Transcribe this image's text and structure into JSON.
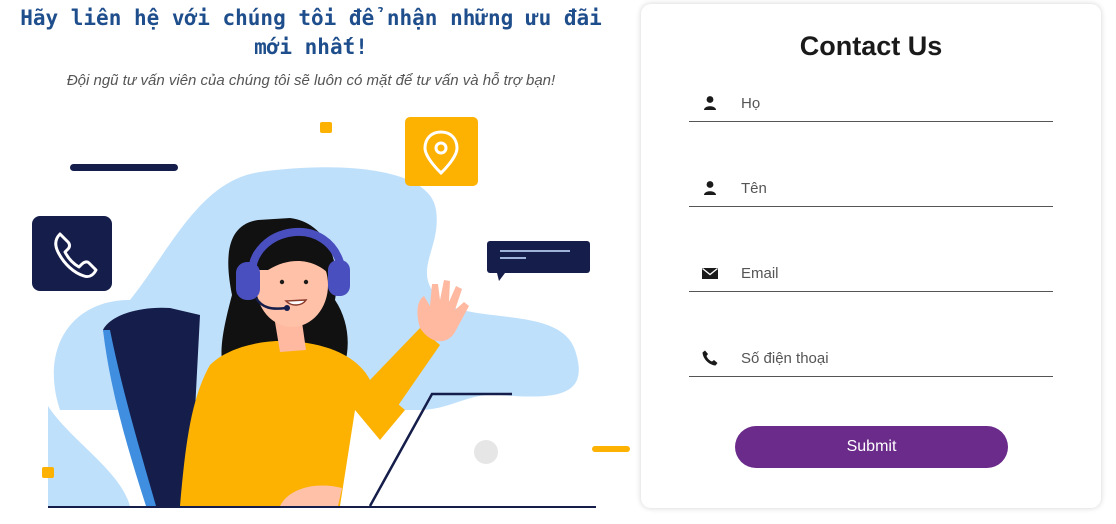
{
  "hero": {
    "headline_line1": "Hãy liên hệ với chúng tôi để nhận những ưu đãi",
    "headline_line2": "mới nhất!",
    "subtitle": "Đội ngũ tư vấn viên của chúng tôi sẽ luôn có mặt để tư vấn và hỗ trợ bạn!"
  },
  "form": {
    "title": "Contact Us",
    "fields": [
      {
        "icon": "user-icon",
        "placeholder": "Họ",
        "value": ""
      },
      {
        "icon": "user-icon",
        "placeholder": "Tên",
        "value": ""
      },
      {
        "icon": "envelope-icon",
        "placeholder": "Email",
        "value": ""
      },
      {
        "icon": "phone-icon",
        "placeholder": "Số điện thoại",
        "value": ""
      }
    ],
    "submit_label": "Submit"
  },
  "colors": {
    "headline": "#1f4e8c",
    "submit_bg": "#6a2b8a",
    "accent_orange": "#fdb100",
    "navy": "#151d4a",
    "blob_blue": "#bfe0fb"
  }
}
